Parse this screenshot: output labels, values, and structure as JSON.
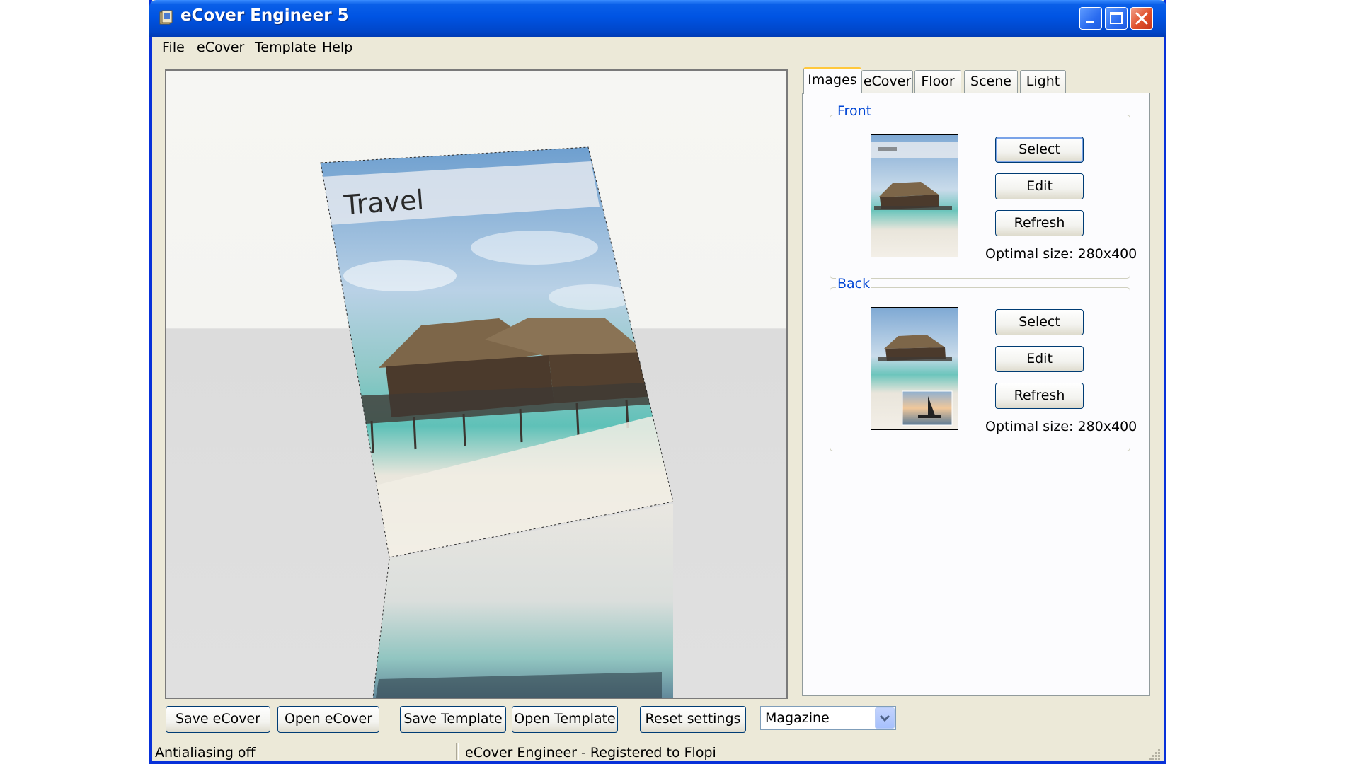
{
  "window": {
    "title": "eCover Engineer 5"
  },
  "menu": [
    "File",
    "eCover",
    "Template",
    "Help"
  ],
  "tabs": [
    {
      "label": "Images",
      "active": true
    },
    {
      "label": "eCover",
      "active": false
    },
    {
      "label": "Floor",
      "active": false
    },
    {
      "label": "Scene",
      "active": false
    },
    {
      "label": "Light",
      "active": false
    }
  ],
  "images_tab": {
    "front": {
      "label": "Front",
      "select_label": "Select",
      "edit_label": "Edit",
      "refresh_label": "Refresh",
      "optimal_size": "Optimal size: 280x400"
    },
    "back": {
      "label": "Back",
      "select_label": "Select",
      "edit_label": "Edit",
      "refresh_label": "Refresh",
      "optimal_size": "Optimal size: 280x400"
    }
  },
  "preview": {
    "cover_title": "Travel"
  },
  "toolbar": {
    "save_ecover": "Save eCover",
    "open_ecover": "Open eCover",
    "save_template": "Save Template",
    "open_template": "Open Template",
    "reset_settings": "Reset settings",
    "template_type": "Magazine"
  },
  "status": {
    "left": "Antialiasing off",
    "right": "eCover Engineer - Registered to Flopi"
  },
  "colors": {
    "titlebar": "#0054e3",
    "window_bg": "#ece9d8",
    "group_label": "#0046d5",
    "active_tab_accent": "#ffc83c"
  }
}
